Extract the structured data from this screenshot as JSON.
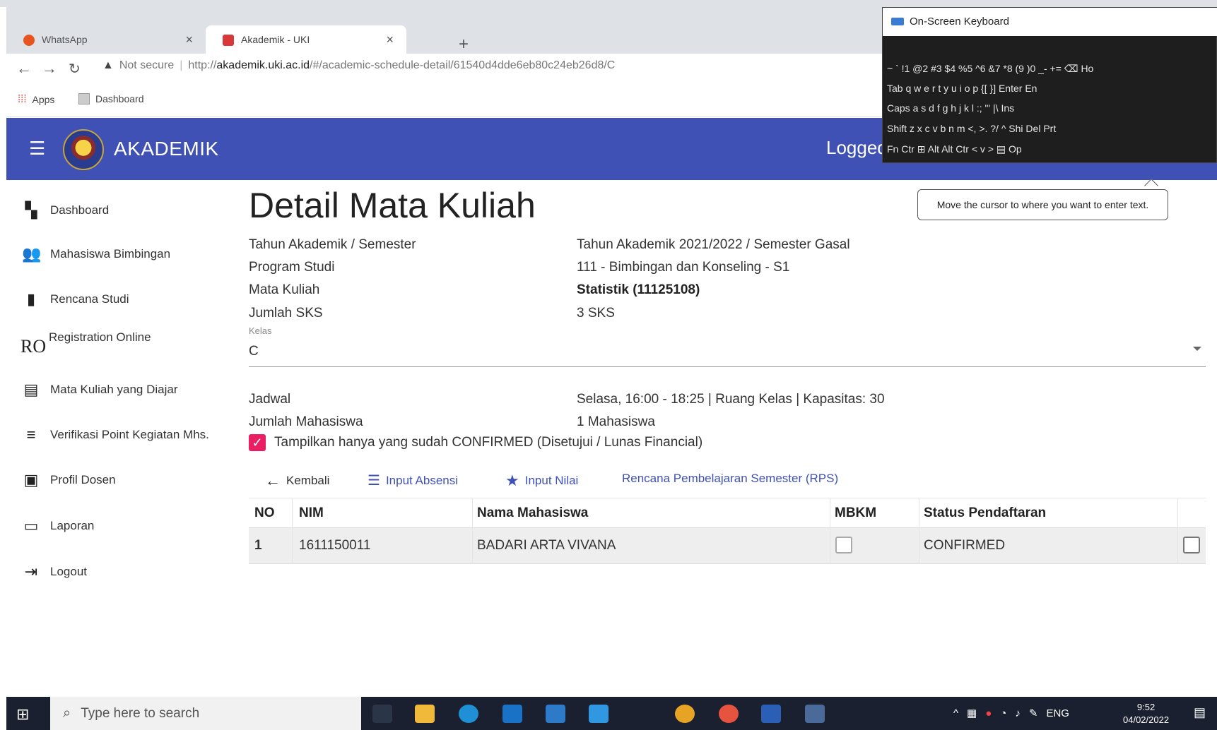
{
  "browser": {
    "tabs": [
      {
        "title": "WhatsApp",
        "close": "×"
      },
      {
        "title": "Akademik - UKI",
        "close": "×"
      }
    ],
    "new_tab": "+",
    "security": "Not secure",
    "url_prefix": "http://",
    "url_host": "akademik.uki.ac.id",
    "url_path": "/#/academic-schedule-detail/61540d4dde6eb80c24eb26d8/C",
    "bookmarks": [
      "Apps",
      "Dashboard"
    ]
  },
  "app": {
    "title": "AKADEMIK",
    "logged_in": "Logged"
  },
  "sidebar": {
    "items": [
      {
        "icon": "dashboard-icon",
        "label": "Dashboard"
      },
      {
        "icon": "people-icon",
        "label": "Mahasiswa Bimbingan"
      },
      {
        "icon": "book-icon",
        "label": "Rencana Studi"
      },
      {
        "icon": "ro-text-icon",
        "icon_text": "RO",
        "label": "Registration Online"
      },
      {
        "icon": "library-books-icon",
        "label": "Mata Kuliah yang Diajar"
      },
      {
        "icon": "playlist-check-icon",
        "label": "Verifikasi Point Kegiatan Mhs."
      },
      {
        "icon": "account-box-icon",
        "label": "Profil Dosen"
      },
      {
        "icon": "folder-icon",
        "label": "Laporan"
      },
      {
        "icon": "logout-icon",
        "label": "Logout"
      }
    ]
  },
  "main": {
    "title": "Detail Mata Kuliah",
    "fields": [
      {
        "label": "Tahun Akademik / Semester",
        "value": "Tahun Akademik 2021/2022 / Semester Gasal"
      },
      {
        "label": "Program Studi",
        "value": "111 - Bimbingan dan Konseling - S1"
      },
      {
        "label": "Mata Kuliah",
        "value": "Statistik (11125108)"
      },
      {
        "label": "Jumlah SKS",
        "value": "3 SKS"
      }
    ],
    "kelas_label": "Kelas",
    "kelas_value": "C",
    "fields2": [
      {
        "label": "Jadwal",
        "value": "Selasa, 16:00 - 18:25 | Ruang Kelas | Kapasitas: 30"
      },
      {
        "label": "Jumlah Mahasiswa",
        "value": "1 Mahasiswa"
      }
    ],
    "confirm_filter": "Tampilkan hanya yang sudah CONFIRMED (Disetujui / Lunas Financial)",
    "actions": {
      "back": "Kembali",
      "absensi": "Input Absensi",
      "nilai": "Input Nilai",
      "rps": "Rencana Pembelajaran Semester (RPS)"
    },
    "table": {
      "headers": [
        "NO",
        "NIM",
        "Nama Mahasiswa",
        "MBKM",
        "Status Pendaftaran"
      ],
      "rows": [
        {
          "no": "1",
          "nim": "1611150011",
          "nama": "BADARI ARTA VIVANA",
          "status": "CONFIRMED"
        }
      ]
    }
  },
  "osk": {
    "title": "On-Screen Keyboard",
    "rows": [
      "~  `  !1  @2  #3  $4  %5  ^6  &7  *8  (9  )0  _-  +=  ⌫   Ho",
      "Tab  q   w   e   r   t   y   u   i   o   p   {[   }]    Enter   En",
      "Caps  a   s   d   f   g   h   j   k   l   :;   \"'   |\\            Ins",
      "Shift      z   x   c   v   b   n   m   <,   >.   ?/   ^  Shi Del  Prt",
      "Fn  Ctr  ⊞  Alt                                  Alt Ctr  <   v   >   ▤   Op"
    ],
    "tooltip": "Move the cursor to where you want to enter text."
  },
  "taskbar": {
    "search_placeholder": "Type here to search",
    "lang": "ENG",
    "time": "9:52",
    "date": "04/02/2022"
  },
  "colors": {
    "appbar": "#3f51b5",
    "accent_pink": "#e91e63",
    "link_blue": "#3f51b5"
  }
}
